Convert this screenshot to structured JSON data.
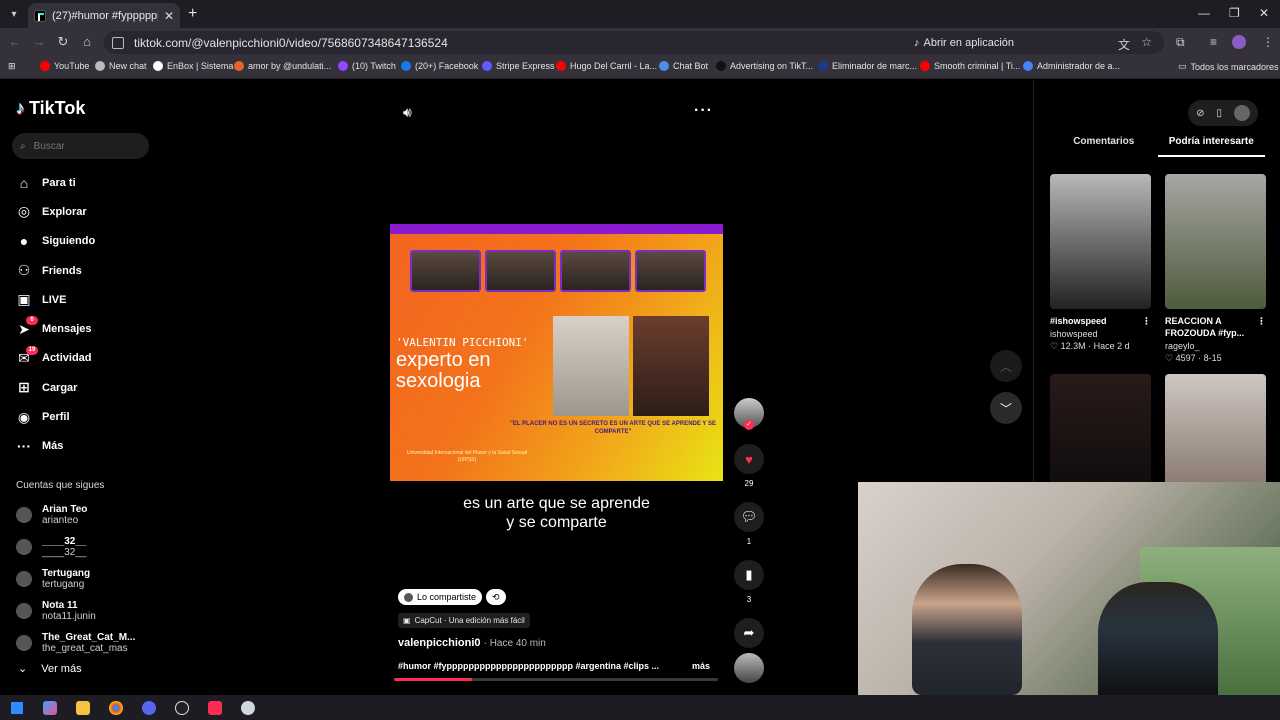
{
  "browser": {
    "tab_title": "(27)#humor #fypppppppppppp",
    "url": "tiktok.com/@valenpicchioni0/video/7568607348647136524",
    "open_app_label": "Abrir en aplicación",
    "bookmarks": [
      {
        "label": "YouTube",
        "color": "#ff0000"
      },
      {
        "label": "New chat",
        "color": "#bbbbbb"
      },
      {
        "label": "EnBox | Sistema",
        "color": "#ffffff"
      },
      {
        "label": "amor by @undulati...",
        "color": "#e8642a"
      },
      {
        "label": "(10) Twitch",
        "color": "#9146ff"
      },
      {
        "label": "(20+) Facebook",
        "color": "#1877f2"
      },
      {
        "label": "Stripe Express",
        "color": "#635bff"
      },
      {
        "label": "Hugo Del Carril - La...",
        "color": "#ff0000"
      },
      {
        "label": "Chat Bot",
        "color": "#4a90e2"
      },
      {
        "label": "Advertising on TikT...",
        "color": "#111111"
      },
      {
        "label": "Eliminador de marc...",
        "color": "#1a3a8a"
      },
      {
        "label": "Smooth criminal | Ti...",
        "color": "#ff0000"
      },
      {
        "label": "Administrador de a...",
        "color": "#4285f4"
      }
    ],
    "bookmarks_all": "Todos los marcadores"
  },
  "sidebar": {
    "logo": "TikTok",
    "search_placeholder": "Buscar",
    "nav": [
      {
        "label": "Para ti",
        "icon": "home-icon"
      },
      {
        "label": "Explorar",
        "icon": "compass-icon"
      },
      {
        "label": "Siguiendo",
        "icon": "following-icon"
      },
      {
        "label": "Friends",
        "icon": "friends-icon"
      },
      {
        "label": "LIVE",
        "icon": "live-icon"
      },
      {
        "label": "Mensajes",
        "icon": "messages-icon",
        "badge": "6"
      },
      {
        "label": "Actividad",
        "icon": "activity-icon",
        "badge": "19"
      },
      {
        "label": "Cargar",
        "icon": "upload-icon"
      },
      {
        "label": "Perfil",
        "icon": "profile-icon"
      },
      {
        "label": "Más",
        "icon": "more-icon"
      }
    ],
    "following_title": "Cuentas que sigues",
    "following": [
      {
        "name": "Arian Teo",
        "user": "arianteo"
      },
      {
        "name": "____32__",
        "user": "____32__"
      },
      {
        "name": "Tertugang",
        "user": "tertugang"
      },
      {
        "name": "Nota 11",
        "user": "nota11.junin"
      },
      {
        "name": "The_Great_Cat_M...",
        "user": "the_great_cat_mas"
      }
    ],
    "see_more": "Ver más"
  },
  "video": {
    "overlay_name": "'VALENTIN PICCHIONI'",
    "overlay_title": "experto en sexologia",
    "overlay_quote": "\"EL PLACER NO ES UN SECRETO  ES UN ARTE QUE SE APRENDE Y SE COMPARTE\"",
    "overlay_uni": "Universidad Internacional del Placer y la Salud Sexual [UIPSS]",
    "subtitle_line1": "es un arte que se aprende",
    "subtitle_line2": "y se comparte",
    "shared_label": "Lo compartiste",
    "capcut_label": "CapCut · Una edición más fácil",
    "author": "valenpicchioni0",
    "time": "· Hace 40 min",
    "description": "#humor #fyppppppppppppppppppppppp #argentina #clips ...",
    "more_label": "más",
    "progress": 0.24,
    "likes": "29",
    "comments": "1",
    "saves": "3",
    "shares": "1"
  },
  "right_panel": {
    "tabs": [
      "Comentarios",
      "Podría interesarte"
    ],
    "active_tab": 1,
    "cards": [
      {
        "title": "#ishowspeed",
        "user": "ishowspeed",
        "meta": "♡ 12.3M · Hace 2 d"
      },
      {
        "title": "REACCION A FROZOUDA #fyp...",
        "user": "rageylo_",
        "meta": "♡ 4597 · 8-15"
      },
      {
        "title": "",
        "user": "",
        "meta": ""
      },
      {
        "title": "",
        "user": "",
        "meta": ""
      }
    ]
  },
  "colors": {
    "accent": "#fe2c55",
    "background": "#000000"
  }
}
